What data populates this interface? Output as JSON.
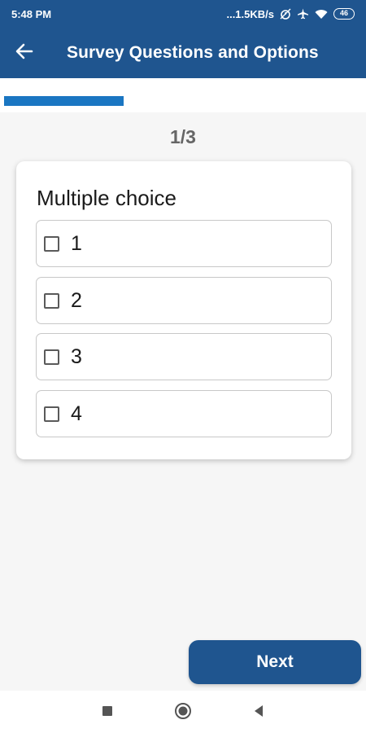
{
  "status_bar": {
    "time": "5:48 PM",
    "network_speed": "...1.5KB/s",
    "battery": "46",
    "icons": [
      "alarm-icon",
      "airplane-icon",
      "wifi-icon",
      "battery-icon"
    ]
  },
  "toolbar": {
    "back_icon": "arrow-left-icon",
    "title": "Survey Questions and Options"
  },
  "progress": {
    "current": 1,
    "total": 3,
    "fraction": 0.333
  },
  "page_counter": "1/3",
  "question": {
    "title": "Multiple choice",
    "options": [
      {
        "label": "1",
        "checked": false
      },
      {
        "label": "2",
        "checked": false
      },
      {
        "label": "3",
        "checked": false
      },
      {
        "label": "4",
        "checked": false
      }
    ]
  },
  "next_button": {
    "label": "Next"
  },
  "nav_bar": {
    "icons": [
      "recents-square-icon",
      "home-circle-icon",
      "back-triangle-icon"
    ]
  },
  "colors": {
    "primary": "#1f558f",
    "progress": "#1a76c2",
    "background": "#f6f6f6"
  }
}
